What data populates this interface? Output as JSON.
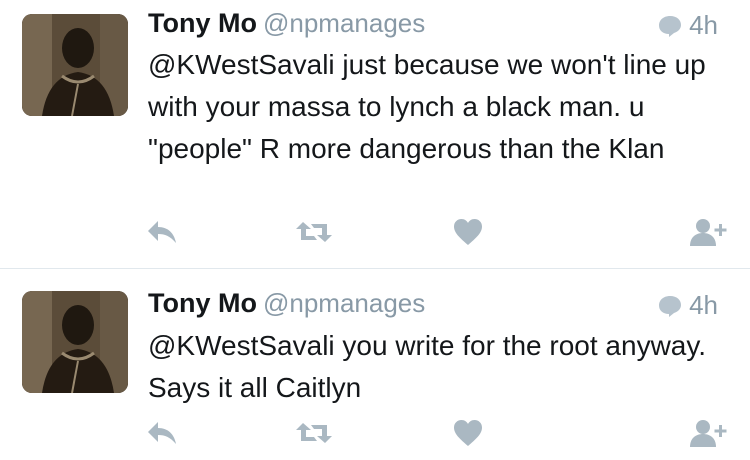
{
  "tweets": [
    {
      "name": "Tony Mo",
      "handle": "@npmanages",
      "time": "4h",
      "text": "@KWestSavali just because we won't line up with your massa to lynch a black man. u \"people\" R more dangerous than the Klan"
    },
    {
      "name": "Tony Mo",
      "handle": "@npmanages",
      "time": "4h",
      "text": "@KWestSavali you write for the root anyway.  Says it all Caitlyn"
    }
  ],
  "colors": {
    "icon": "#aab8c2",
    "meta": "#8899a6",
    "divider": "#e1e8ed"
  },
  "icons": {
    "reply": "reply-icon",
    "retweet": "retweet-icon",
    "like": "heart-icon",
    "follow": "follow-user-icon",
    "time": "reply-count-bubble-icon"
  }
}
